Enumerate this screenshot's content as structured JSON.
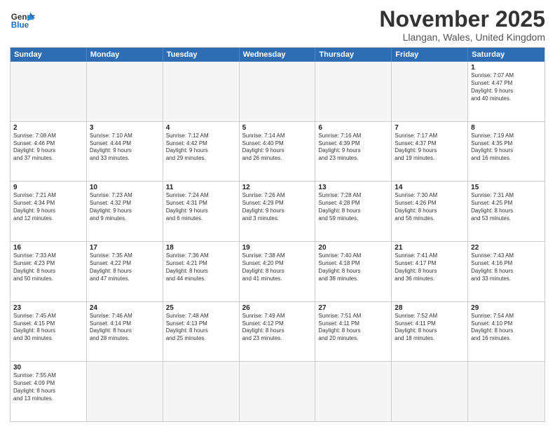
{
  "logo": {
    "general": "General",
    "blue": "Blue"
  },
  "title": "November 2025",
  "subtitle": "Llangan, Wales, United Kingdom",
  "header_days": [
    "Sunday",
    "Monday",
    "Tuesday",
    "Wednesday",
    "Thursday",
    "Friday",
    "Saturday"
  ],
  "weeks": [
    [
      {
        "day": "",
        "empty": true
      },
      {
        "day": "",
        "empty": true
      },
      {
        "day": "",
        "empty": true
      },
      {
        "day": "",
        "empty": true
      },
      {
        "day": "",
        "empty": true
      },
      {
        "day": "",
        "empty": true
      },
      {
        "day": "1",
        "info": "Sunrise: 7:07 AM\nSunset: 4:47 PM\nDaylight: 9 hours\nand 40 minutes."
      }
    ],
    [
      {
        "day": "2",
        "info": "Sunrise: 7:08 AM\nSunset: 4:46 PM\nDaylight: 9 hours\nand 37 minutes."
      },
      {
        "day": "3",
        "info": "Sunrise: 7:10 AM\nSunset: 4:44 PM\nDaylight: 9 hours\nand 33 minutes."
      },
      {
        "day": "4",
        "info": "Sunrise: 7:12 AM\nSunset: 4:42 PM\nDaylight: 9 hours\nand 29 minutes."
      },
      {
        "day": "5",
        "info": "Sunrise: 7:14 AM\nSunset: 4:40 PM\nDaylight: 9 hours\nand 26 minutes."
      },
      {
        "day": "6",
        "info": "Sunrise: 7:16 AM\nSunset: 4:39 PM\nDaylight: 9 hours\nand 23 minutes."
      },
      {
        "day": "7",
        "info": "Sunrise: 7:17 AM\nSunset: 4:37 PM\nDaylight: 9 hours\nand 19 minutes."
      },
      {
        "day": "8",
        "info": "Sunrise: 7:19 AM\nSunset: 4:35 PM\nDaylight: 9 hours\nand 16 minutes."
      }
    ],
    [
      {
        "day": "9",
        "info": "Sunrise: 7:21 AM\nSunset: 4:34 PM\nDaylight: 9 hours\nand 12 minutes."
      },
      {
        "day": "10",
        "info": "Sunrise: 7:23 AM\nSunset: 4:32 PM\nDaylight: 9 hours\nand 9 minutes."
      },
      {
        "day": "11",
        "info": "Sunrise: 7:24 AM\nSunset: 4:31 PM\nDaylight: 9 hours\nand 6 minutes."
      },
      {
        "day": "12",
        "info": "Sunrise: 7:26 AM\nSunset: 4:29 PM\nDaylight: 9 hours\nand 3 minutes."
      },
      {
        "day": "13",
        "info": "Sunrise: 7:28 AM\nSunset: 4:28 PM\nDaylight: 8 hours\nand 59 minutes."
      },
      {
        "day": "14",
        "info": "Sunrise: 7:30 AM\nSunset: 4:26 PM\nDaylight: 8 hours\nand 56 minutes."
      },
      {
        "day": "15",
        "info": "Sunrise: 7:31 AM\nSunset: 4:25 PM\nDaylight: 8 hours\nand 53 minutes."
      }
    ],
    [
      {
        "day": "16",
        "info": "Sunrise: 7:33 AM\nSunset: 4:23 PM\nDaylight: 8 hours\nand 50 minutes."
      },
      {
        "day": "17",
        "info": "Sunrise: 7:35 AM\nSunset: 4:22 PM\nDaylight: 8 hours\nand 47 minutes."
      },
      {
        "day": "18",
        "info": "Sunrise: 7:36 AM\nSunset: 4:21 PM\nDaylight: 8 hours\nand 44 minutes."
      },
      {
        "day": "19",
        "info": "Sunrise: 7:38 AM\nSunset: 4:20 PM\nDaylight: 8 hours\nand 41 minutes."
      },
      {
        "day": "20",
        "info": "Sunrise: 7:40 AM\nSunset: 4:18 PM\nDaylight: 8 hours\nand 38 minutes."
      },
      {
        "day": "21",
        "info": "Sunrise: 7:41 AM\nSunset: 4:17 PM\nDaylight: 8 hours\nand 36 minutes."
      },
      {
        "day": "22",
        "info": "Sunrise: 7:43 AM\nSunset: 4:16 PM\nDaylight: 8 hours\nand 33 minutes."
      }
    ],
    [
      {
        "day": "23",
        "info": "Sunrise: 7:45 AM\nSunset: 4:15 PM\nDaylight: 8 hours\nand 30 minutes."
      },
      {
        "day": "24",
        "info": "Sunrise: 7:46 AM\nSunset: 4:14 PM\nDaylight: 8 hours\nand 28 minutes."
      },
      {
        "day": "25",
        "info": "Sunrise: 7:48 AM\nSunset: 4:13 PM\nDaylight: 8 hours\nand 25 minutes."
      },
      {
        "day": "26",
        "info": "Sunrise: 7:49 AM\nSunset: 4:12 PM\nDaylight: 8 hours\nand 23 minutes."
      },
      {
        "day": "27",
        "info": "Sunrise: 7:51 AM\nSunset: 4:11 PM\nDaylight: 8 hours\nand 20 minutes."
      },
      {
        "day": "28",
        "info": "Sunrise: 7:52 AM\nSunset: 4:11 PM\nDaylight: 8 hours\nand 18 minutes."
      },
      {
        "day": "29",
        "info": "Sunrise: 7:54 AM\nSunset: 4:10 PM\nDaylight: 8 hours\nand 16 minutes."
      }
    ],
    [
      {
        "day": "30",
        "info": "Sunrise: 7:55 AM\nSunset: 4:09 PM\nDaylight: 8 hours\nand 13 minutes."
      },
      {
        "day": "",
        "empty": true
      },
      {
        "day": "",
        "empty": true
      },
      {
        "day": "",
        "empty": true
      },
      {
        "day": "",
        "empty": true
      },
      {
        "day": "",
        "empty": true
      },
      {
        "day": "",
        "empty": true
      }
    ]
  ]
}
